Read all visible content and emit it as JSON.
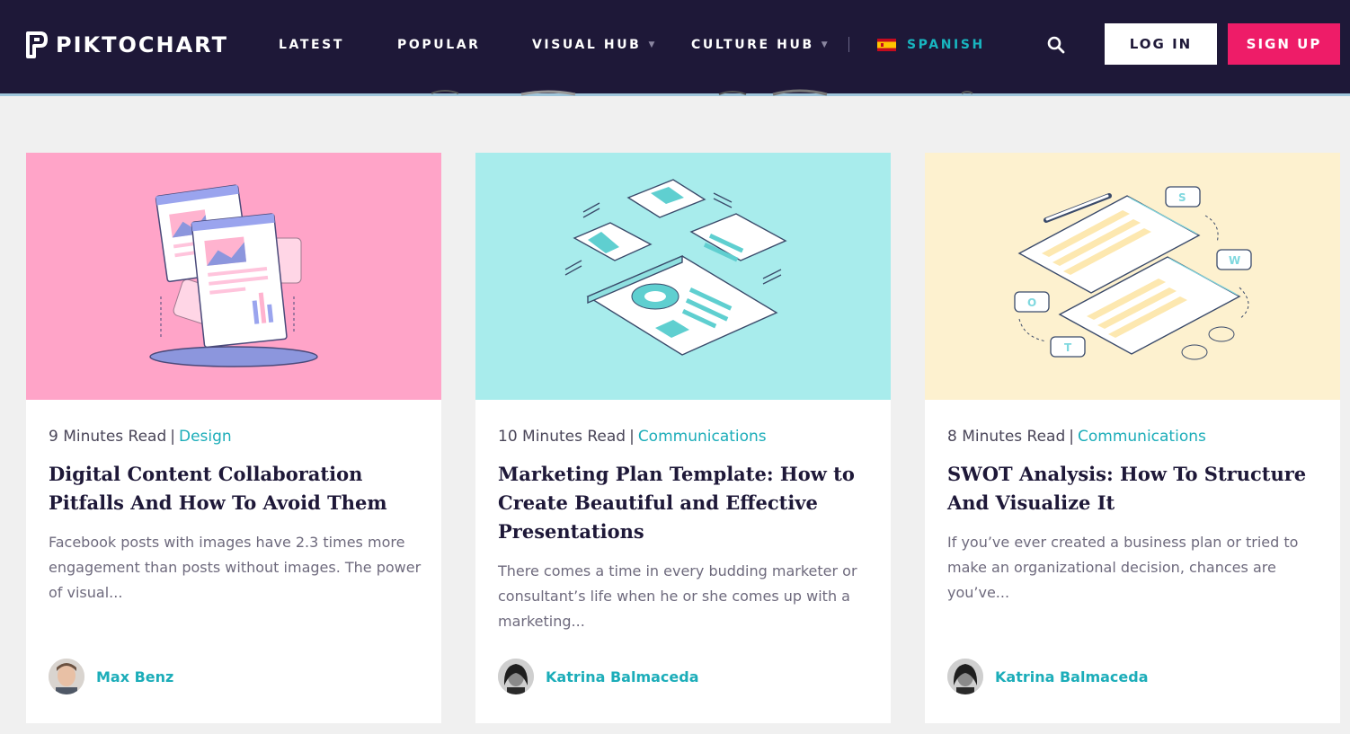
{
  "header": {
    "logo_text": "PIKTOCHART",
    "nav": [
      {
        "label": "LATEST",
        "has_dropdown": false
      },
      {
        "label": "POPULAR",
        "has_dropdown": false
      },
      {
        "label": "VISUAL HUB",
        "has_dropdown": true
      },
      {
        "label": "CULTURE HUB",
        "has_dropdown": true
      }
    ],
    "language": {
      "label": "SPANISH",
      "flag": "spain-flag-icon"
    },
    "search_icon": "search-icon",
    "login_label": "LOG IN",
    "signup_label": "SIGN UP"
  },
  "colors": {
    "header_bg": "#1e1838",
    "accent_teal": "#1cadb9",
    "signup_pink": "#ee1c68",
    "page_bg": "#f0f0f0",
    "card1_image_bg": "#ffa4c8",
    "card2_image_bg": "#a8ecec",
    "card3_image_bg": "#fdf1cf"
  },
  "cards": [
    {
      "read_time": "9 Minutes Read",
      "separator": "|",
      "category": "Design",
      "title": "Digital Content Collaboration Pitfalls And How To Avoid Them",
      "excerpt": "Facebook posts with images have 2.3 times more engagement than posts without images. The power of visual...",
      "author": "Max Benz"
    },
    {
      "read_time": "10 Minutes Read",
      "separator": "|",
      "category": "Communications",
      "title": "Marketing Plan Template: How to Create Beautiful and Effective Presentations",
      "excerpt": "There comes a time in every budding marketer or consultant’s life when he or she comes up with a marketing...",
      "author": "Katrina Balmaceda"
    },
    {
      "read_time": "8 Minutes Read",
      "separator": "|",
      "category": "Communications",
      "title": "SWOT Analysis: How To Structure And Visualize It",
      "excerpt": "If you’ve ever created a business plan or tried to make an organizational decision, chances are you’ve...",
      "author": "Katrina Balmaceda"
    }
  ]
}
